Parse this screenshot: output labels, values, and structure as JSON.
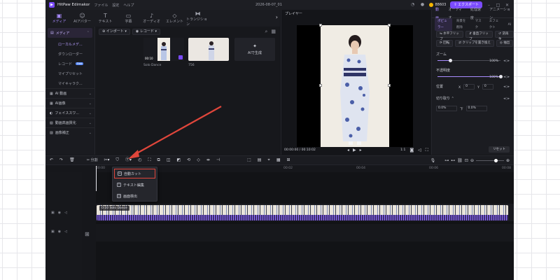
{
  "titlebar": {
    "app_name": "HitPaw Edimakor",
    "menu": [
      "ファイル",
      "設定",
      "ヘルプ"
    ],
    "doc_title": "2026-08-07_01",
    "credits": "88603",
    "export_label": "エクスポート"
  },
  "top_tabs": [
    {
      "label": "メディア",
      "icon": "media-icon"
    },
    {
      "label": "AIアバター",
      "icon": "avatar-icon"
    },
    {
      "label": "テキスト",
      "icon": "text-icon"
    },
    {
      "label": "字幕",
      "icon": "subtitle-icon"
    },
    {
      "label": "オーディオ",
      "icon": "audio-icon"
    },
    {
      "label": "エレメント",
      "icon": "element-icon"
    },
    {
      "label": "トランジション",
      "icon": "transition-icon"
    }
  ],
  "sidebar": {
    "media_label": "メディア",
    "sub_items": [
      "ローカルメデ...",
      "ダウンローダー",
      "レコード",
      "マイプリセット",
      "マイキャラク..."
    ],
    "new_badge": "Free",
    "groups": [
      "AI 動画",
      "AI画像",
      "フェイススワ...",
      "動画高画質化",
      "画像補正"
    ]
  },
  "media_panel": {
    "import_label": "インポート",
    "record_label": "レコード",
    "items": [
      {
        "name": "Solo Dance",
        "duration": "00:10"
      },
      {
        "name": "756",
        "duration": ""
      }
    ],
    "ai_generate": "AIで生成"
  },
  "player": {
    "title": "プレイヤー",
    "current_time": "00:00:00",
    "total_time": "00:10:02",
    "ratio": "1:1"
  },
  "props": {
    "tabs": [
      "動画",
      "オーディオ",
      "処理速度",
      "アニメーション"
    ],
    "sub_tabs": [
      "ポピュラー",
      "背景を削除",
      "マスク",
      "エフェクト",
      "AI"
    ],
    "buttons_row1": [
      "水平フリップ",
      "垂直フリップ",
      "逆再生"
    ],
    "buttons_row2": [
      "回転",
      "クリップを置き換え",
      "抽出"
    ],
    "zoom_label": "ズーム",
    "zoom_value": "100%",
    "zoom_level": 0.2,
    "opacity_label": "不透明度",
    "opacity_value": "100%",
    "opacity_level": 1.0,
    "position_label": "位置",
    "x_label": "X",
    "x_value": "0",
    "y_label": "Y",
    "y_value": "0",
    "crop_label": "切り取り",
    "crop_left_value": "0.0%",
    "crop_right_label": "下",
    "crop_right_value": "0.0%",
    "reset_label": "リセット"
  },
  "timeline": {
    "split_label": "分割",
    "ruler": [
      "00:00",
      "00:02",
      "00:04",
      "00:06",
      "00:08",
      "00:10",
      "00:12"
    ],
    "clip_label": "0:10 Solo Dance"
  },
  "dropdown": {
    "items": [
      "自動カット",
      "テキスト編集",
      "画面検出"
    ],
    "highlighted": "自動カット"
  },
  "colors": {
    "accent": "#7b4bff",
    "highlight_box": "#e0463b",
    "arrow": "#e0463b"
  }
}
